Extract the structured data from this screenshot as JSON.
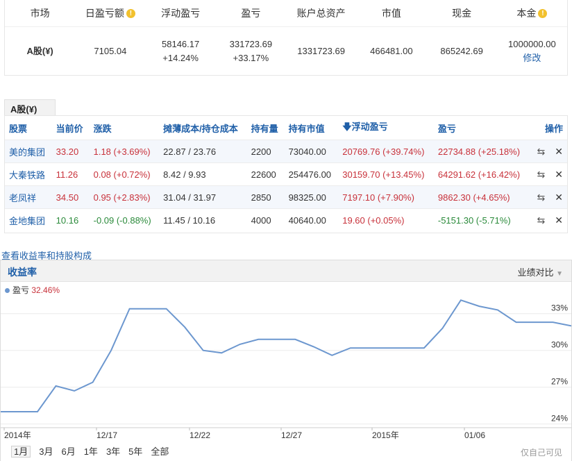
{
  "summary": {
    "headers": [
      "市场",
      "日盈亏额",
      "浮动盈亏",
      "盈亏",
      "账户总资产",
      "市值",
      "现金",
      "本金"
    ],
    "market": "A股(¥)",
    "daily_pnl": "7105.04",
    "float_pnl": "58146.17",
    "float_pnl_pct": "+14.24%",
    "pnl": "331723.69",
    "pnl_pct": "+33.17%",
    "total_assets": "1331723.69",
    "market_value": "466481.00",
    "cash": "865242.69",
    "principal": "1000000.00",
    "edit_label": "修改"
  },
  "holdings": {
    "tab_label": "A股(¥)",
    "headers": [
      "股票",
      "当前价",
      "涨跌",
      "摊薄成本/持仓成本",
      "持有量",
      "持有市值",
      "浮动盈亏",
      "盈亏",
      "操作"
    ],
    "rows": [
      {
        "name": "美的集团",
        "price": "33.20",
        "change": "1.18 (+3.69%)",
        "cost": "22.87 / 23.76",
        "qty": "2200",
        "value": "73040.00",
        "float_pnl": "20769.76 (+39.74%)",
        "pnl": "22734.88 (+25.18%)",
        "dir": "up",
        "pnl_dir": "up"
      },
      {
        "name": "大秦铁路",
        "price": "11.26",
        "change": "0.08 (+0.72%)",
        "cost": "8.42 / 9.93",
        "qty": "22600",
        "value": "254476.00",
        "float_pnl": "30159.70 (+13.45%)",
        "pnl": "64291.62 (+16.42%)",
        "dir": "up",
        "pnl_dir": "up"
      },
      {
        "name": "老凤祥",
        "price": "34.50",
        "change": "0.95 (+2.83%)",
        "cost": "31.04 / 31.97",
        "qty": "2850",
        "value": "98325.00",
        "float_pnl": "7197.10 (+7.90%)",
        "pnl": "9862.30 (+4.65%)",
        "dir": "up",
        "pnl_dir": "up"
      },
      {
        "name": "金地集团",
        "price": "10.16",
        "change": "-0.09 (-0.88%)",
        "cost": "11.45 / 10.16",
        "qty": "4000",
        "value": "40640.00",
        "float_pnl": "19.60 (+0.05%)",
        "pnl": "-5151.30 (-5.71%)",
        "dir": "down",
        "pnl_dir": "down"
      }
    ]
  },
  "chart_section": {
    "view_link": "查看收益率和持股构成",
    "title": "收益率",
    "compare_label": "业绩对比",
    "legend_name": "盈亏",
    "legend_value": "32.46%",
    "watermark": "仅自己可见",
    "ranges": [
      "1月",
      "3月",
      "6月",
      "1年",
      "3年",
      "5年",
      "全部"
    ],
    "active_range": "1月"
  },
  "chart_data": {
    "type": "line",
    "x_tick_labels": [
      "2014年",
      "12/17",
      "12/22",
      "12/27",
      "2015年",
      "01/06"
    ],
    "y_tick_labels": [
      "24%",
      "27%",
      "30%",
      "33%"
    ],
    "ylim": [
      23.7,
      34.4
    ],
    "series": [
      {
        "name": "盈亏",
        "color": "#6c97cf",
        "values": [
          25.0,
          25.0,
          25.0,
          27.1,
          26.7,
          27.4,
          30.0,
          33.4,
          33.4,
          33.4,
          31.9,
          30.0,
          29.8,
          30.5,
          30.9,
          30.9,
          30.9,
          30.3,
          29.6,
          30.2,
          30.2,
          30.2,
          30.2,
          30.2,
          31.8,
          34.1,
          33.6,
          33.3,
          32.3,
          32.3,
          32.3,
          32.0
        ]
      }
    ]
  }
}
